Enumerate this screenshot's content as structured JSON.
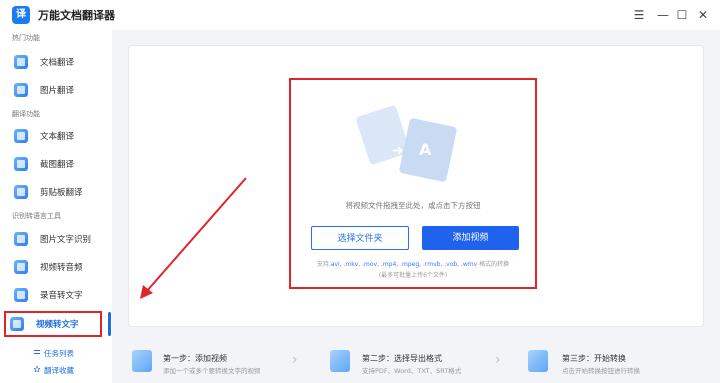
{
  "app": {
    "logo_text": "译",
    "title": "万能文档翻译器"
  },
  "window_controls": {
    "menu": "☰",
    "minimize": "—",
    "maximize": "☐",
    "close": "✕"
  },
  "sidebar": {
    "sections": [
      {
        "label": "热门功能",
        "items": [
          {
            "label": "文档翻译"
          },
          {
            "label": "图片翻译"
          }
        ]
      },
      {
        "label": "翻译功能",
        "items": [
          {
            "label": "文本翻译"
          },
          {
            "label": "截图翻译"
          },
          {
            "label": "剪贴板翻译"
          }
        ]
      },
      {
        "label": "识别转语言工具",
        "items": [
          {
            "label": "图片文字识别"
          },
          {
            "label": "视频转音频"
          },
          {
            "label": "录音转文字"
          },
          {
            "label": "视频转文字",
            "active": true
          }
        ]
      }
    ],
    "sub_items": [
      {
        "label": "任务列表"
      },
      {
        "label": "翻译收藏"
      }
    ]
  },
  "main": {
    "drop_hint": "将视频文件拖拽至此处，或点击下方按钮",
    "select_folder_label": "选择文件夹",
    "add_video_label": "添加视频",
    "support_prefix": "支持",
    "support_formats": ".avi, .mkv, .mov, .mp4, .mpeg, .rmvb, .vob, .wmv",
    "support_suffix": " 格式的转换",
    "limit_note": "(最多可批量上传6个文件)"
  },
  "steps": [
    {
      "title": "第一步：添加视频",
      "desc": "添加一个或多个要转换文字的视频"
    },
    {
      "title": "第二步：选择导出格式",
      "desc": "支持PDF、Word、TXT、SRT格式"
    },
    {
      "title": "第三步：开始转换",
      "desc": "点击开始转换按钮进行转换"
    }
  ],
  "colors": {
    "accent": "#1f62ee",
    "highlight_border": "#e0252a"
  }
}
